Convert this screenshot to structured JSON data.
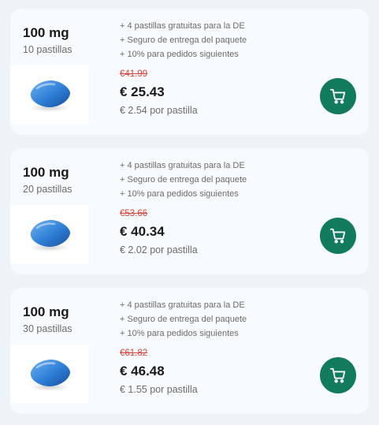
{
  "colors": {
    "page_bg": "#eef3f8",
    "card_bg": "#f7fbfe",
    "old_price": "#d9443a",
    "cart_button": "#127a5d"
  },
  "offers": [
    {
      "dose": "100 mg",
      "count": "10 pastillas",
      "perks": [
        "+ 4 pastillas gratuitas para la DE",
        "+ Seguro de entrega del paquete",
        "+ 10% para pedidos siguientes"
      ],
      "old_price": "€41.99",
      "price": "€ 25.43",
      "per_unit": "€ 2.54 por pastilla",
      "cart_icon": "cart-icon"
    },
    {
      "dose": "100 mg",
      "count": "20 pastillas",
      "perks": [
        "+ 4 pastillas gratuitas para la DE",
        "+ Seguro de entrega del paquete",
        "+ 10% para pedidos siguientes"
      ],
      "old_price": "€53.66",
      "price": "€ 40.34",
      "per_unit": "€ 2.02 por pastilla",
      "cart_icon": "cart-icon"
    },
    {
      "dose": "100 mg",
      "count": "30 pastillas",
      "perks": [
        "+ 4 pastillas gratuitas para la DE",
        "+ Seguro de entrega del paquete",
        "+ 10% para pedidos siguientes"
      ],
      "old_price": "€61.82",
      "price": "€ 46.48",
      "per_unit": "€ 1.55 por pastilla",
      "cart_icon": "cart-icon"
    }
  ]
}
